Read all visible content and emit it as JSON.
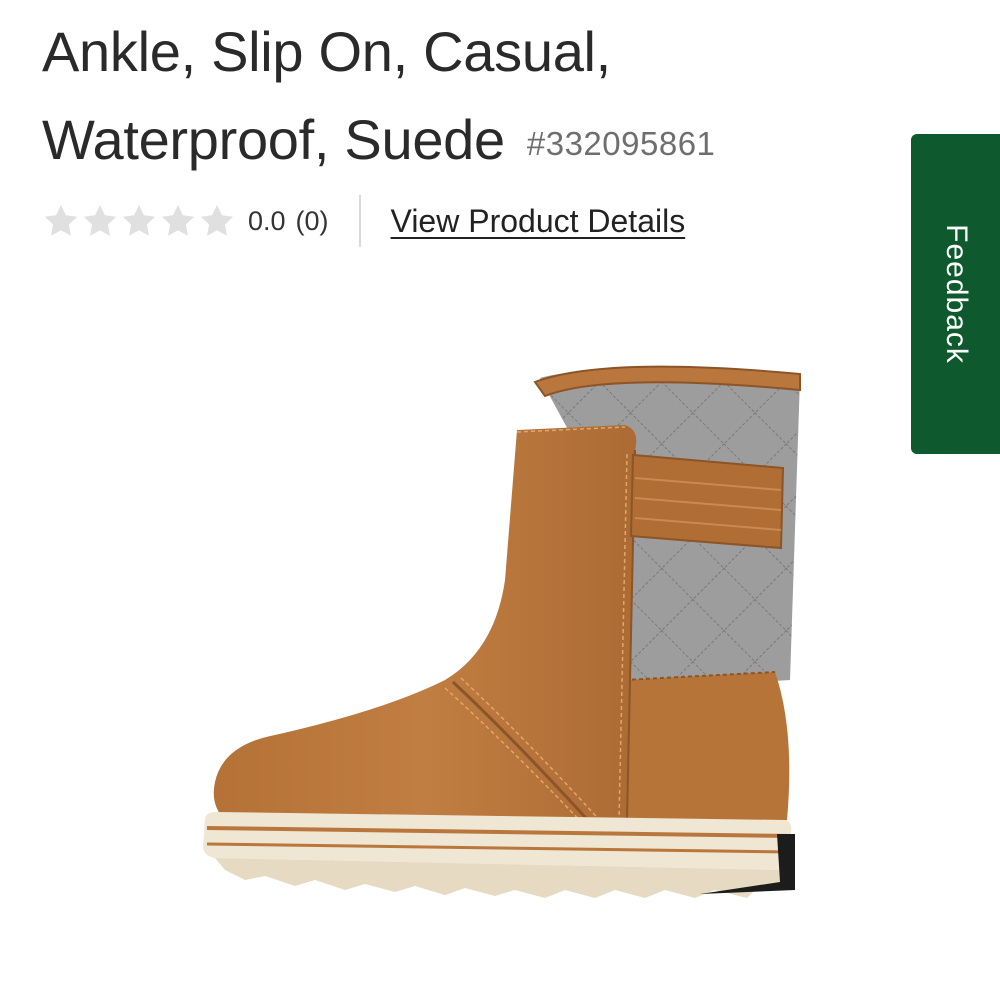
{
  "product": {
    "title": "Ankle, Slip On, Casual, Waterproof, Suede",
    "sku": "#332095861",
    "rating": {
      "value": "0.0",
      "count": "(0)",
      "stars_filled": 0,
      "stars_total": 5
    },
    "details_link": "View Product Details"
  },
  "feedback": {
    "label": "Feedback"
  },
  "colors": {
    "feedback_bg": "#0e5a2e",
    "star_empty": "#e0e0e0",
    "suede": "#b9773d",
    "felt": "#9c9c9c"
  },
  "icons": {
    "star": "star-icon"
  }
}
